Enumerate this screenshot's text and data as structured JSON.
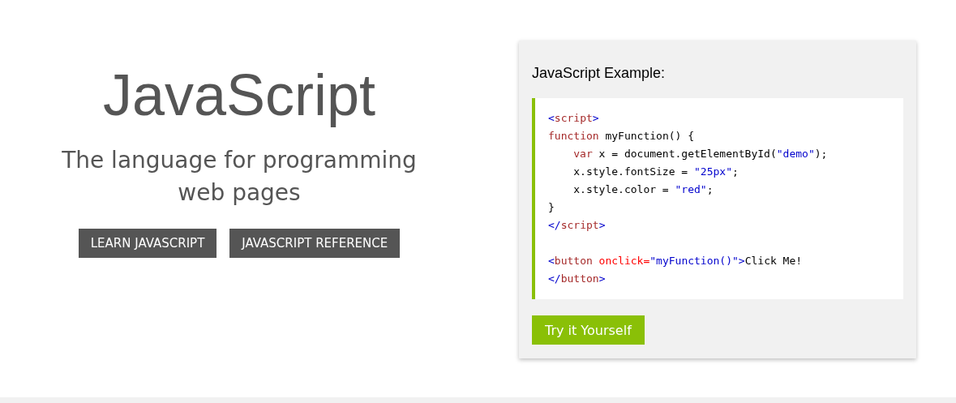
{
  "hero": {
    "title": "JavaScript",
    "subtitle": "The language for programming web pages",
    "buttons": [
      "LEARN JAVASCRIPT",
      "JAVASCRIPT REFERENCE"
    ]
  },
  "example": {
    "heading": "JavaScript Example:",
    "code_lines": [
      {
        "kind": "code",
        "indented": false,
        "tokens": [
          {
            "kind": "bracket",
            "text": "<"
          },
          {
            "kind": "tagname",
            "text": "script"
          },
          {
            "kind": "bracket",
            "text": ">"
          }
        ]
      },
      {
        "kind": "code",
        "indented": false,
        "tokens": [
          {
            "kind": "keyword",
            "text": "function"
          },
          {
            "kind": "plain",
            "text": " myFunction() {"
          }
        ]
      },
      {
        "kind": "code",
        "indented": true,
        "tokens": [
          {
            "kind": "keyword",
            "text": "var"
          },
          {
            "kind": "plain",
            "text": " x = document.getElementById("
          },
          {
            "kind": "string",
            "text": "\"demo\""
          },
          {
            "kind": "plain",
            "text": ");"
          }
        ]
      },
      {
        "kind": "code",
        "indented": true,
        "tokens": [
          {
            "kind": "plain",
            "text": "x.style.fontSize = "
          },
          {
            "kind": "string",
            "text": "\"25px\""
          },
          {
            "kind": "plain",
            "text": ";"
          }
        ]
      },
      {
        "kind": "code",
        "indented": true,
        "tokens": [
          {
            "kind": "plain",
            "text": "x.style.color = "
          },
          {
            "kind": "string",
            "text": "\"red\""
          },
          {
            "kind": "plain",
            "text": ";"
          }
        ]
      },
      {
        "kind": "code",
        "indented": false,
        "tokens": [
          {
            "kind": "plain",
            "text": "}"
          }
        ]
      },
      {
        "kind": "code",
        "indented": false,
        "tokens": [
          {
            "kind": "bracket",
            "text": "</"
          },
          {
            "kind": "tagname",
            "text": "script"
          },
          {
            "kind": "bracket",
            "text": ">"
          }
        ]
      },
      {
        "kind": "blank"
      },
      {
        "kind": "code",
        "indented": false,
        "tokens": [
          {
            "kind": "bracket",
            "text": "<"
          },
          {
            "kind": "tagname",
            "text": "button"
          },
          {
            "kind": "attr",
            "text": " onclick="
          },
          {
            "kind": "string",
            "text": "\"myFunction()\""
          },
          {
            "kind": "bracket",
            "text": ">"
          },
          {
            "kind": "plain",
            "text": "Click Me!"
          }
        ]
      },
      {
        "kind": "code",
        "indented": false,
        "tokens": [
          {
            "kind": "bracket",
            "text": "</"
          },
          {
            "kind": "tagname",
            "text": "button"
          },
          {
            "kind": "bracket",
            "text": ">"
          }
        ]
      }
    ],
    "button": "Try it Yourself"
  }
}
